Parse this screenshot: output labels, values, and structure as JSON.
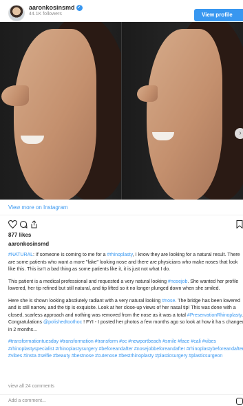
{
  "header": {
    "username": "aaronkosinsmd",
    "followers": "44.1K followers",
    "view_profile_label": "View profile",
    "verified_icon": "✓"
  },
  "post": {
    "view_more_label": "View more on Instagram",
    "likes": "877 likes",
    "author": "aaronkosinsmd",
    "carousel": {
      "count": 7,
      "active_index": 0
    },
    "caption": {
      "p1": [
        {
          "t": "#NATURAL",
          "tag": true
        },
        {
          "t": ": If someone is coming to me for a ",
          "tag": false
        },
        {
          "t": "#rhinoplasty",
          "tag": true
        },
        {
          "t": ", I know they are looking for a natural result. There are some patients who want a more \"fake\" looking nose and there are physicians who make noses that look like this. This isn't a bad thing as some patients like it, it is just not what I do.",
          "tag": false
        }
      ],
      "p2": [
        {
          "t": "This patient is a medical professional and requested a very natural looking ",
          "tag": false
        },
        {
          "t": "#nosejob",
          "tag": true
        },
        {
          "t": ". She wanted her profile lowered, her tip refined but still natural, and tip lifted so it no longer plunged down when she smiled.",
          "tag": false
        }
      ],
      "p3": [
        {
          "t": "Here she is shown looking absolutely radiant with a very natural looking ",
          "tag": false
        },
        {
          "t": "#nose",
          "tag": true
        },
        {
          "t": ". The bridge has been lowered and is still narrow, and the tip is exquisite. Look at her close-up views of her nasal tip! This was done with a closed, scarless approach and nothing was removed from the nose as it was a total ",
          "tag": false
        },
        {
          "t": "#PreservationRhinoplasty",
          "tag": true
        },
        {
          "t": ". Congratulations ",
          "tag": false
        },
        {
          "t": "@polishedtoothoc",
          "tag": true
        },
        {
          "t": " ! FYI - I posted her photos a few months ago so look at how it ha s changed in 2 months...",
          "tag": false
        }
      ],
      "p4": [
        {
          "t": "#transformationtuesday #transformation #transform #oc #newportbeach #smile #face #cali #vibes #rhinoplastyspecialist #rhinoplastysurgery #beforeandafter #nosejobbeforeandafter #rhinoplastybeforeandafter #vibes #insta #selfie #beauty #bestnose #cutenose #bestrhinoplasty #plasticsurgery #plasticsurgeon",
          "tag": true
        }
      ]
    },
    "view_comments_label": "view all 24 comments",
    "add_comment_placeholder": "Add a comment..."
  },
  "icons": {
    "heart": "heart-icon",
    "comment": "comment-icon",
    "share": "share-icon",
    "bookmark": "bookmark-icon",
    "next": "chevron-right-icon",
    "instagram": "instagram-icon"
  },
  "colors": {
    "accent": "#3897f0",
    "text": "#262626",
    "muted": "#8e8e8e"
  }
}
